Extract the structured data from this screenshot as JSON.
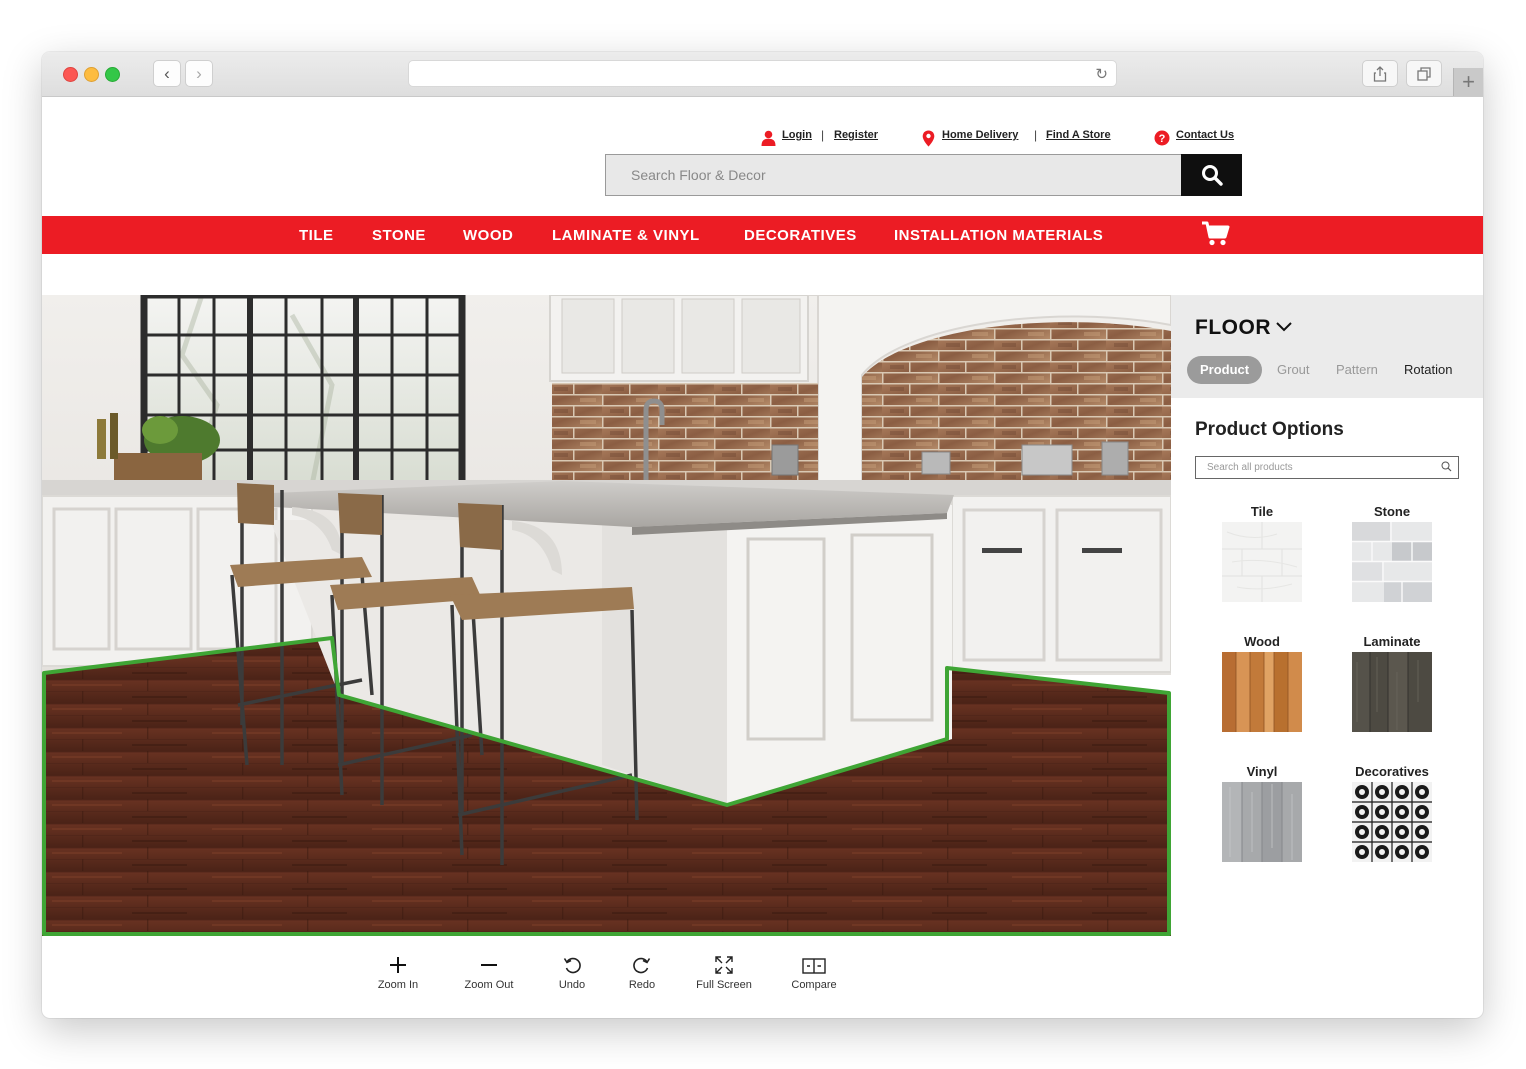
{
  "header": {
    "login": "Login",
    "register": "Register",
    "home_delivery": "Home Delivery",
    "find_store": "Find A Store",
    "contact": "Contact Us",
    "search_placeholder": "Search Floor & Decor"
  },
  "nav": {
    "items": [
      "TILE",
      "STONE",
      "WOOD",
      "LAMINATE & VINYL",
      "DECORATIVES",
      "INSTALLATION MATERIALS"
    ]
  },
  "toolbar": {
    "zoom_in": "Zoom In",
    "zoom_out": "Zoom Out",
    "undo": "Undo",
    "redo": "Redo",
    "full_screen": "Full Screen",
    "compare": "Compare"
  },
  "panel": {
    "surface": "FLOOR",
    "tabs": [
      "Product",
      "Grout",
      "Pattern",
      "Rotation"
    ],
    "active_tab": "Product",
    "options_title": "Product Options",
    "search_placeholder": "Search all products",
    "categories": [
      "Tile",
      "Stone",
      "Wood",
      "Laminate",
      "Vinyl",
      "Decoratives"
    ]
  },
  "colors": {
    "brand_red": "#ec1c24",
    "selection_outline": "#3fa535",
    "active_tab": "#9b9b9b"
  }
}
